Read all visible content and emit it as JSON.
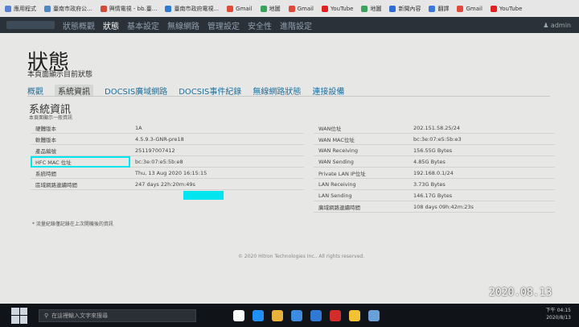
{
  "bookmarks": [
    {
      "label": "應用程式",
      "color": "#5a7fd6"
    },
    {
      "label": "臺南市政府公...",
      "color": "#4f86c6"
    },
    {
      "label": "興情電視 - bb.臺...",
      "color": "#d24b3a"
    },
    {
      "label": "臺南市政府電視...",
      "color": "#2e7bd6"
    },
    {
      "label": "Gmail",
      "color": "#e04a3a"
    },
    {
      "label": "地圖",
      "color": "#3aa35a"
    },
    {
      "label": "Gmail",
      "color": "#e04a3a"
    },
    {
      "label": "YouTube",
      "color": "#e02020"
    },
    {
      "label": "地圖",
      "color": "#3aa35a"
    },
    {
      "label": "新聞內容",
      "color": "#2d6bd6"
    },
    {
      "label": "翻譯",
      "color": "#3a78e0"
    },
    {
      "label": "Gmail",
      "color": "#e04a3a"
    },
    {
      "label": "YouTube",
      "color": "#e02020"
    }
  ],
  "topnav": {
    "items": [
      "狀態",
      "基本設定",
      "無線網路",
      "管理設定",
      "安全性",
      "進階設定"
    ],
    "pre": "狀態概觀",
    "active": "狀態",
    "user": "admin"
  },
  "page": {
    "title": "狀態",
    "subtitle": "本頁面顯示目前狀態",
    "tabs": [
      "概觀",
      "系統資訊",
      "DOCSIS廣域網路",
      "DOCSIS事件紀錄",
      "無線網路狀態",
      "連接設備"
    ],
    "active_tab": "系統資訊",
    "section_title": "系統資訊",
    "section_subtitle": "本頁面顯示一般資訊",
    "left_rows": [
      [
        "硬體版本",
        "1A"
      ],
      [
        "軟體版本",
        "4.5.9.3-GNR-pre18"
      ],
      [
        "產品編號",
        "251197007412"
      ],
      [
        "HFC MAC 位址",
        "bc:3e:07:e5:5b:e8"
      ],
      [
        "系統時間",
        "Thu, 13 Aug 2020 16:15:15"
      ],
      [
        "區域網路連續時間",
        "247 days 22h:20m:49s"
      ]
    ],
    "right_rows": [
      [
        "WAN位址",
        "202.151.58.25/24"
      ],
      [
        "WAN MAC位址",
        "bc:3e:07:e5:5b:e3"
      ],
      [
        "WAN Receiving",
        "156.55G Bytes"
      ],
      [
        "WAN Sending",
        "4.85G Bytes"
      ],
      [
        "Private LAN IP位址",
        "192.168.0.1/24"
      ],
      [
        "LAN Receiving",
        "3.73G Bytes"
      ],
      [
        "LAN Sending",
        "146.17G Bytes"
      ],
      [
        "廣域網路連續時間",
        "108 days 09h:42m:23s"
      ]
    ],
    "note": "* 流量紀錄僅記錄在上次開機後的資訊",
    "copyright": "© 2020 Hitron Technologies Inc.. All rights reserved."
  },
  "stamp": "2020.08.13",
  "taskbar": {
    "search_placeholder": "在這裡輸入文字來搜尋",
    "time": "下午 04:15",
    "date": "2020/8/13",
    "icons": [
      {
        "name": "task-view-icon",
        "color": "#ffffff"
      },
      {
        "name": "edge-icon",
        "color": "#1e90ff"
      },
      {
        "name": "file-explorer-icon",
        "color": "#e8b33a"
      },
      {
        "name": "store-icon",
        "color": "#3c8ce0"
      },
      {
        "name": "mail-icon",
        "color": "#2f7ad6"
      },
      {
        "name": "acrobat-icon",
        "color": "#d42b2b"
      },
      {
        "name": "chrome-icon",
        "color": "#f1c232"
      },
      {
        "name": "monitor-icon",
        "color": "#6aa0d8"
      }
    ]
  }
}
